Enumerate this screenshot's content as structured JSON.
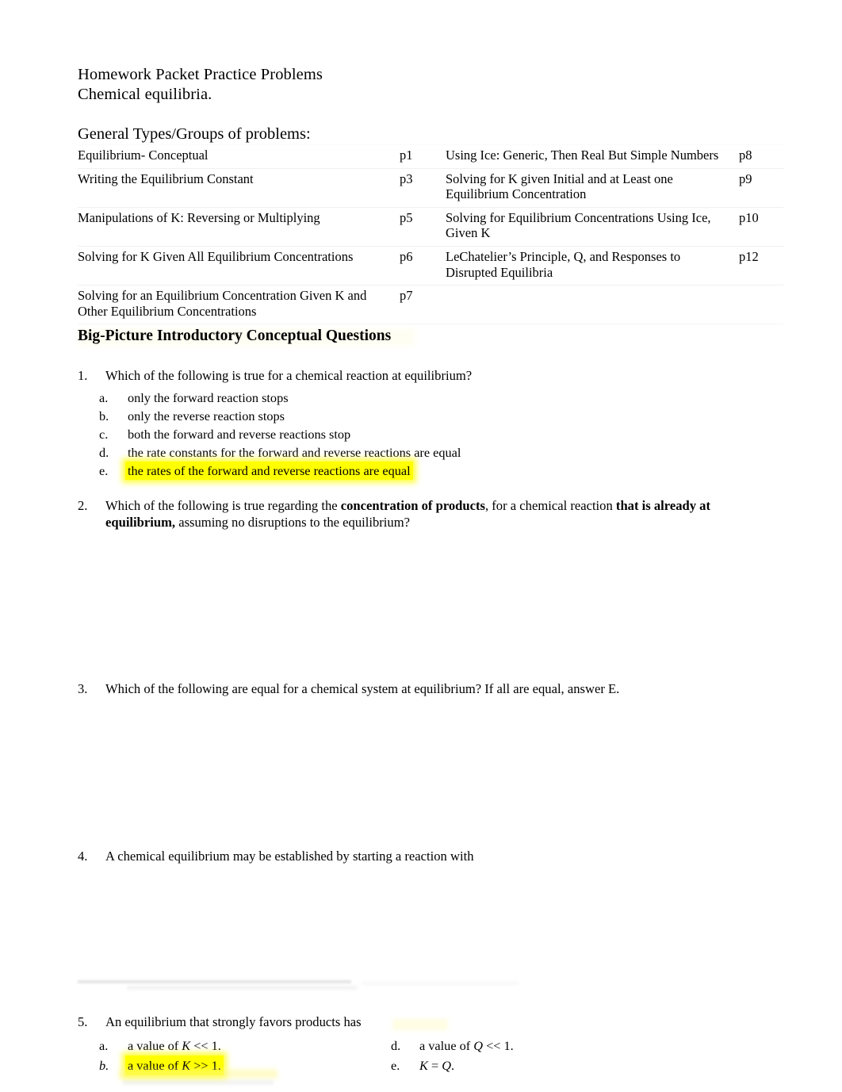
{
  "document": {
    "title_line1": "Homework Packet Practice Problems",
    "title_line2": "Chemical equilibria.",
    "section_label": "General Types/Groups of problems:"
  },
  "toc": {
    "rows": [
      {
        "left_topic": "Equilibrium- Conceptual",
        "left_page": "p1",
        "right_topic": "Using Ice:  Generic, Then Real But Simple Numbers",
        "right_page": "p8"
      },
      {
        "left_topic": "Writing the Equilibrium Constant",
        "left_page": "p3",
        "right_topic": "Solving for K given Initial and at Least one Equilibrium Concentration",
        "right_page": "p9"
      },
      {
        "left_topic": "Manipulations of K:  Reversing or Multiplying",
        "left_page": "p5",
        "right_topic": "Solving for Equilibrium Concentrations Using Ice, Given K",
        "right_page": "p10"
      },
      {
        "left_topic": "Solving for K Given All Equilibrium Concentrations",
        "left_page": "p6",
        "right_topic": "LeChatelier’s Principle, Q, and Responses to Disrupted Equilibria",
        "right_page": "p12"
      },
      {
        "left_topic": "Solving for an Equilibrium Concentration Given K and Other Equilibrium Concentrations",
        "left_page": "p7",
        "right_topic": "",
        "right_page": ""
      }
    ]
  },
  "big_heading": "Big-Picture Introductory Conceptual Questions",
  "questions": [
    {
      "number": "1.",
      "text": "Which of the following is true for a chemical reaction at equilibrium?",
      "choices": [
        {
          "letter": "a.",
          "text": "only the forward reaction stops",
          "highlighted": false
        },
        {
          "letter": "b.",
          "text": "only the reverse reaction stops",
          "highlighted": false
        },
        {
          "letter": "c.",
          "text": "both the forward and reverse reactions stop",
          "highlighted": false
        },
        {
          "letter": "d.",
          "text": "the rate constants for the forward and reverse reactions are equal",
          "highlighted": false
        },
        {
          "letter": "e.",
          "text": "the rates of the forward and reverse reactions are  equal",
          "highlighted": true
        }
      ]
    },
    {
      "number": "2.",
      "text_part1": "Which of the following is true regarding the ",
      "bold1": "concentration of products",
      "text_part2": ", for a chemical reaction ",
      "bold2": "that is already at equilibrium,",
      "text_part3": " assuming no disruptions to the equilibrium?"
    },
    {
      "number": "3.",
      "text": "Which of the following are equal for a chemical system at equilibrium? If all are equal, answer E."
    },
    {
      "number": "4.",
      "text": "A chemical equilibrium may be established by starting a reaction with"
    },
    {
      "number": "5.",
      "text": "An equilibrium that strongly favors products has",
      "choices_left": [
        {
          "letter": "a.",
          "prefix": "a value of ",
          "var": "K",
          "suffix": " << 1.",
          "highlighted": false,
          "italic_letter": false
        },
        {
          "letter": "b.",
          "prefix": "a value of ",
          "var": "K",
          "suffix": " >> 1.",
          "highlighted": true,
          "italic_letter": true
        }
      ],
      "choices_right": [
        {
          "letter": "d.",
          "prefix": "a value of ",
          "var": "Q",
          "suffix": " << 1.",
          "highlighted": false,
          "italic_letter": false
        },
        {
          "letter": "e.",
          "prefix": "",
          "var": "K",
          "suffix": " = ",
          "var2": "Q",
          "suffix2": ".",
          "highlighted": false,
          "italic_letter": false
        }
      ]
    }
  ],
  "colors": {
    "highlight": "#ffff00",
    "text": "#000000",
    "page_background": "#ffffff",
    "table_rule": "#f0f0f0"
  }
}
